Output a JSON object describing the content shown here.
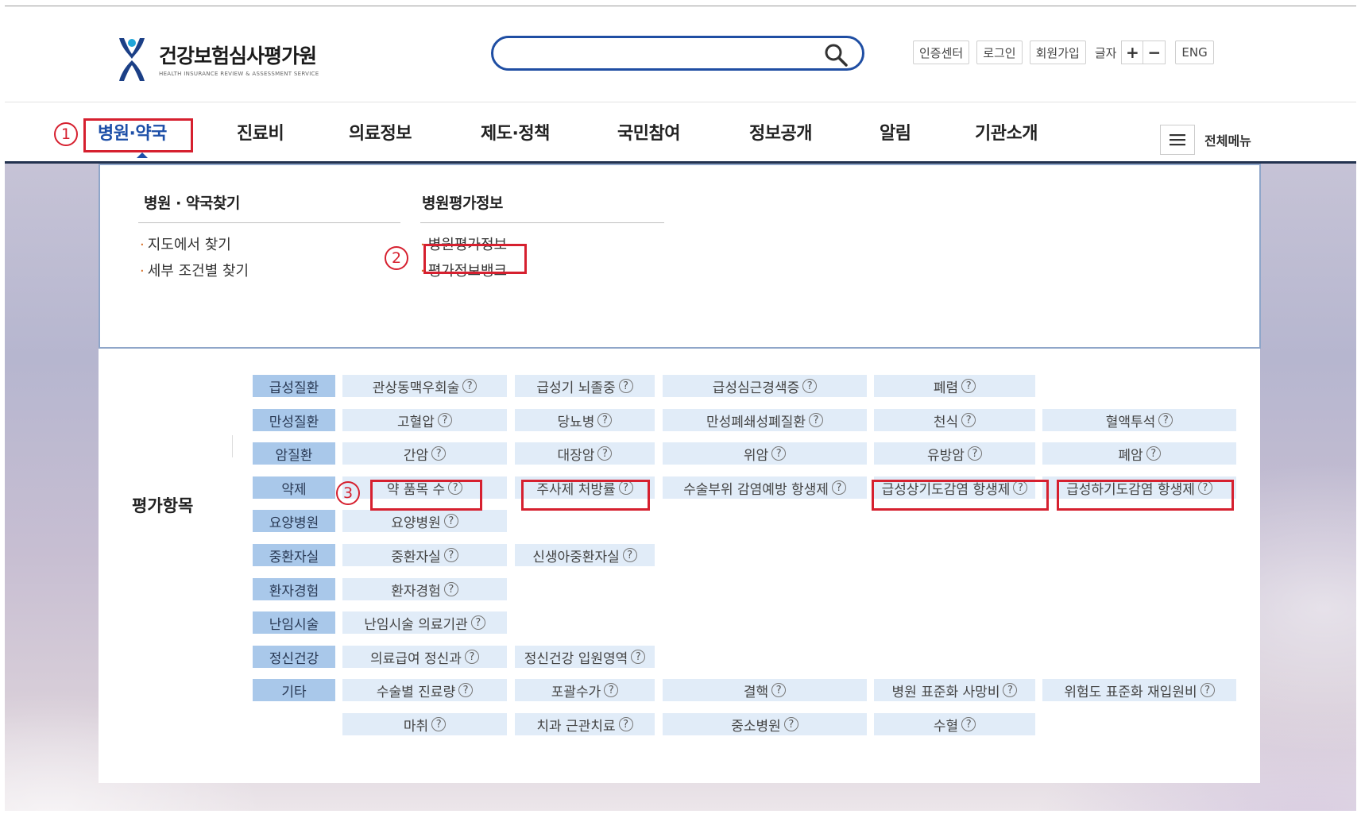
{
  "header": {
    "logo_ko": "건강보험심사평가원",
    "logo_en": "HEALTH INSURANCE REVIEW & ASSESSMENT SERVICE",
    "search_placeholder": "",
    "utility": {
      "cert_center": "인증센터",
      "login": "로그인",
      "signup": "회원가입",
      "font_label": "글자",
      "font_plus": "+",
      "font_minus": "−",
      "eng": "ENG"
    }
  },
  "gnb": {
    "items": [
      "병원·약국",
      "진료비",
      "의료정보",
      "제도·정책",
      "국민참여",
      "정보공개",
      "알림",
      "기관소개"
    ],
    "active_index": 0,
    "all_menu_label": "전체메뉴"
  },
  "dropdown": {
    "col1": {
      "title": "병원 · 약국찾기",
      "links": [
        "지도에서 찾기",
        "세부 조건별 찾기"
      ]
    },
    "col2": {
      "title": "병원평가정보",
      "links": [
        "병원평가정보",
        "평가정보뱅크"
      ]
    }
  },
  "eval": {
    "section_title": "평가항목",
    "rows": [
      {
        "category": "급성질환",
        "items": [
          "관상동맥우회술",
          "급성기 뇌졸중",
          "급성심근경색증",
          "폐렴"
        ]
      },
      {
        "category": "만성질환",
        "items": [
          "고혈압",
          "당뇨병",
          "만성폐쇄성폐질환",
          "천식",
          "혈액투석"
        ]
      },
      {
        "category": "암질환",
        "items": [
          "간암",
          "대장암",
          "위암",
          "유방암",
          "폐암"
        ]
      },
      {
        "category": "약제",
        "items": [
          "약 품목 수",
          "주사제 처방률",
          "수술부위 감염예방 항생제",
          "급성상기도감염 항생제",
          "급성하기도감염 항생제"
        ]
      },
      {
        "category": "요양병원",
        "items": [
          "요양병원"
        ]
      },
      {
        "category": "중환자실",
        "items": [
          "중환자실",
          "신생아중환자실"
        ]
      },
      {
        "category": "환자경험",
        "items": [
          "환자경험"
        ]
      },
      {
        "category": "난임시술",
        "items": [
          "난임시술 의료기관"
        ]
      },
      {
        "category": "정신건강",
        "items": [
          "의료급여 정신과",
          "정신건강 입원영역"
        ]
      },
      {
        "category": "기타",
        "items": [
          "수술별 진료량",
          "포괄수가",
          "결핵",
          "병원 표준화 사망비",
          "위험도 표준화 재입원비"
        ]
      },
      {
        "category": "",
        "items": [
          "마취",
          "치과 근관치료",
          "중소병원",
          "수혈"
        ]
      }
    ],
    "help_glyph": "?"
  },
  "annotations": {
    "step1": "1",
    "step2": "2",
    "step3": "3",
    "color": "#d6202f"
  },
  "colors": {
    "brand_blue": "#1d4fa8",
    "category_bg": "#a9c8ea",
    "item_bg": "#e1ecf8"
  }
}
